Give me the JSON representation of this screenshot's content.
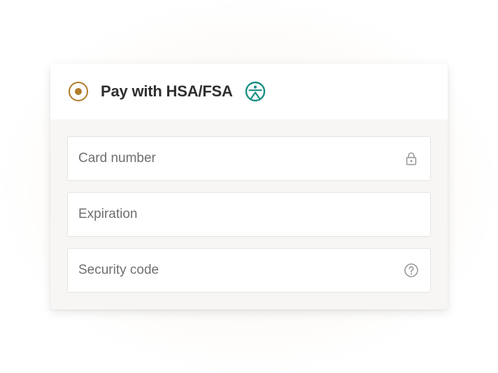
{
  "payment_option": {
    "label": "Pay with HSA/FSA",
    "selected": true,
    "radio_color": "#b07d2a",
    "brand_icon": "person-in-circle-icon",
    "brand_icon_color": "#1a8f83"
  },
  "fields": {
    "card_number": {
      "placeholder": "Card number",
      "value": "",
      "icon": "lock-icon"
    },
    "expiration": {
      "placeholder": "Expiration",
      "value": ""
    },
    "security_code": {
      "placeholder": "Security code",
      "value": "",
      "icon": "help-circle-icon"
    }
  },
  "colors": {
    "panel_background": "#f7f6f4",
    "field_border": "#e6e3de",
    "icon_gray": "#9a9a9a"
  }
}
